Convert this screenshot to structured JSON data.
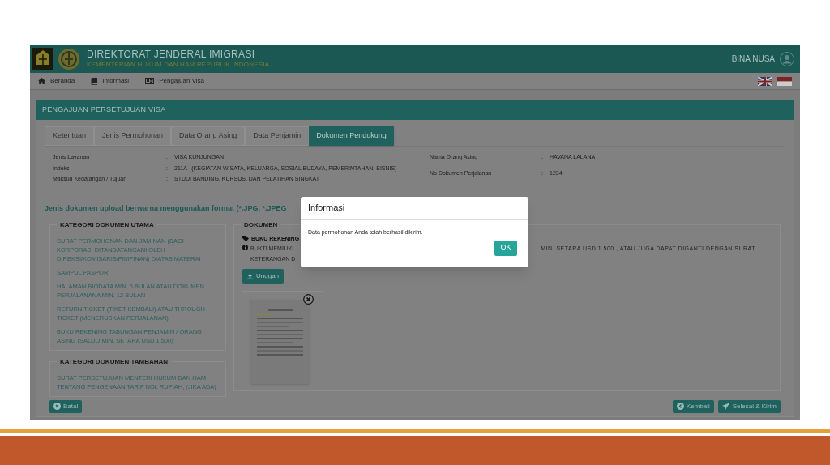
{
  "header": {
    "title": "DIREKTORAT JENDERAL IMIGRASI",
    "subtitle": "KEMENTERIAN HUKUM DAN HAM REPUBLIK INDONESIA",
    "user": "BINA NUSA"
  },
  "nav": [
    {
      "label": "Beranda",
      "kind": "home"
    },
    {
      "label": "Informasi",
      "kind": "book"
    },
    {
      "label": "Pengajuan Visa",
      "kind": "card"
    }
  ],
  "panel_title": "PENGAJUAN PERSETUJUAN VISA",
  "tabs": [
    {
      "label": "Ketentuan",
      "selected": false
    },
    {
      "label": "Jenis Permohonan",
      "selected": false
    },
    {
      "label": "Data Orang Asing",
      "selected": false
    },
    {
      "label": "Data Penjamin",
      "selected": false
    },
    {
      "label": "Dokumen Pendukung",
      "selected": true
    }
  ],
  "info_left": [
    {
      "label": "Jenis Layanan",
      "colon": ":",
      "value": "VISA KUNJUNGAN"
    },
    {
      "label": "Indeks",
      "colon": ":",
      "value": "211A   (KEGIATAN WISATA, KELUARGA, SOSIAL BUDAYA, PEMERINTAHAN, BISNIS)"
    },
    {
      "label": "Maksud Kedatangan / Tujuan",
      "colon": ":",
      "value": "STUDI BANDING, KURSUS, DAN PELATIHAN SINGKAT"
    }
  ],
  "info_right": [
    {
      "label": "Nama Orang Asing",
      "colon": ":",
      "value": "HAVANA LALANA"
    },
    {
      "label": "No Dokumen Perjalanan",
      "colon": ":",
      "value": "1234"
    }
  ],
  "note": "Jenis dokumen upload berwarna menggunakan format (*.JPG, *.JPEG",
  "categories": [
    {
      "title": "KATEGORI DOKUMEN UTAMA",
      "items": [
        "SURAT PERMOHONAN DAN JAMINAN (BAGI KORPORASI DITANDATANGANI OLEH DIREKSI/KOMISARIS/PIMPINAN) DIATAS MATERAI",
        "SAMPUL PASPOR",
        "HALAMAN BIODATA MIN. 6 BULAN ATAU DOKUMEN PERJALANANA MIN. 12 BULAN",
        "RETURN TICKET (TIKET KEMBALI) ATAU THROUGH TICKET (MENERUSKAN PERJALANAN)",
        "BUKU REKENING TABUNGAN PENJAMIN / ORANG ASING (SALDO MIN. SETARA USD 1.500)"
      ]
    },
    {
      "title": "KATEGORI DOKUMEN TAMBAHAN",
      "items": [
        "SURAT PERSETUJUAN MENTERI HUKUM DAN HAM TENTANG PENGENAAN TARIF NOL RUPIAH, (JIKA ADA)"
      ]
    }
  ],
  "documents": {
    "title": "DOKUMEN",
    "name": "BUKU REKENING",
    "desc_left": [
      "BUKTI MEMILIKI",
      "KETERANGAN D"
    ],
    "desc_right": "MIN. SETARA USD 1.500 , ATAU JUGA DAPAT DIGANTI DENGAN SURAT",
    "upload": "Unggah"
  },
  "buttons_left": [
    {
      "label": "Batal",
      "kind": "cancel"
    }
  ],
  "buttons_right": [
    {
      "label": "Kembali",
      "kind": "back"
    },
    {
      "label": "Selesai & Kirim",
      "kind": "send"
    }
  ],
  "dialog": {
    "title": "Informasi",
    "message": "Data permohonan Anda telah berhasil dikirim.",
    "button": "OK"
  }
}
